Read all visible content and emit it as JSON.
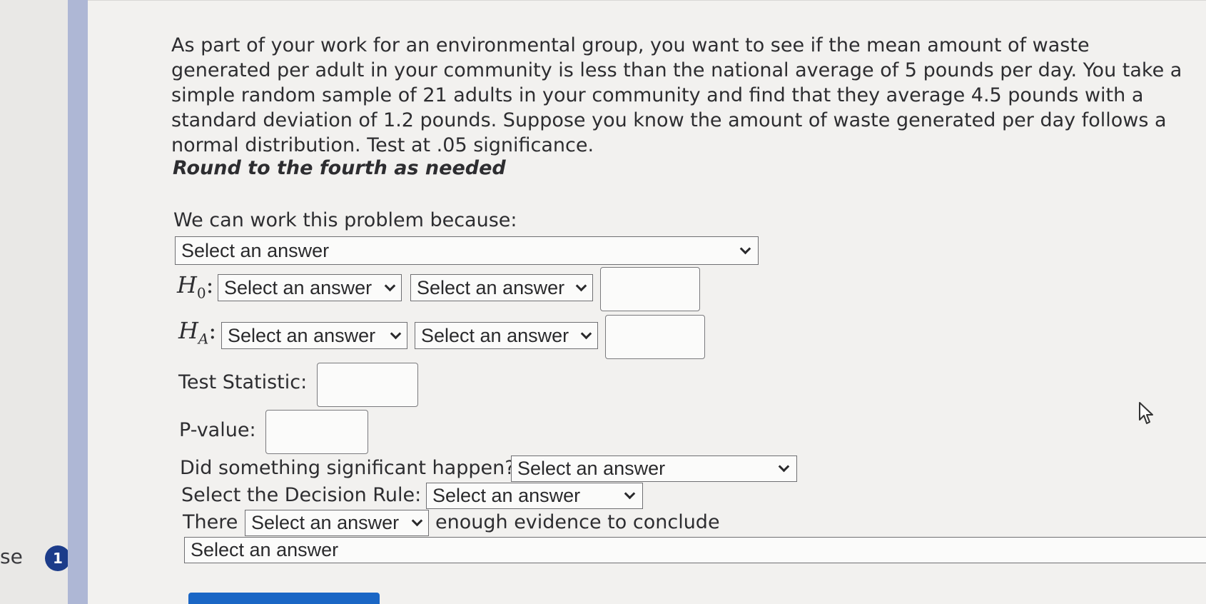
{
  "sidebar": {
    "label": "se",
    "badge": "1"
  },
  "question": {
    "text": "As part of your work for an environmental group, you want to see if the mean amount of waste generated per adult in your community is less than the national average of 5 pounds per day. You take a simple random sample of 21 adults in your community and find that they average 4.5 pounds with a standard deviation of 1.2 pounds. Suppose you know the amount of waste generated per day follows a normal distribution. Test at .05 significance.",
    "rounding_note": "Round to the fourth as needed"
  },
  "form": {
    "reason_label": "We can work this problem because:",
    "reason_select": "Select an answer",
    "h0_symbol": "H",
    "h0_sub": "0",
    "h0_colon": ":",
    "h0_select1": "Select an answer",
    "h0_select2": "Select an answer",
    "ha_symbol": "H",
    "ha_sub": "A",
    "ha_colon": ":",
    "ha_select1": "Select an answer",
    "ha_select2": "Select an answer",
    "test_statistic_label": "Test Statistic:",
    "pvalue_label": "P-value:",
    "significant_label": "Did something significant happen?",
    "significant_select": "Select an answer",
    "decision_rule_label": "Select the Decision Rule:",
    "decision_rule_select": "Select an answer",
    "there_label": "There",
    "there_select": "Select an answer",
    "enough_evidence_label": "enough evidence to conclude",
    "conclusion_select": "Select an answer"
  },
  "colors": {
    "accent_bar": "#aeb7d5",
    "badge": "#1c3c8a",
    "submit_button": "#1a66c5"
  }
}
